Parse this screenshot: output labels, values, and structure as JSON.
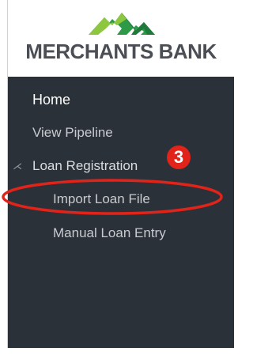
{
  "brand": {
    "name": "MERCHANTS BANK",
    "logo_icon": "mountain-logo-icon",
    "logo_colors": [
      "#8dc63f",
      "#2e9a48"
    ],
    "text_color": "#4b4f55"
  },
  "sidebar": {
    "background": "#2b3138",
    "items": [
      {
        "label": "Home"
      },
      {
        "label": "View Pipeline"
      },
      {
        "label": "Loan Registration",
        "expanded": true,
        "icon": "collapse-caret-icon"
      },
      {
        "label": "Import Loan File"
      },
      {
        "label": "Manual Loan Entry"
      }
    ]
  },
  "annotation": {
    "step_number": "3",
    "badge_color": "#e2231a",
    "highlight_color": "#e2231a",
    "highlight_target": "Import Loan File"
  }
}
